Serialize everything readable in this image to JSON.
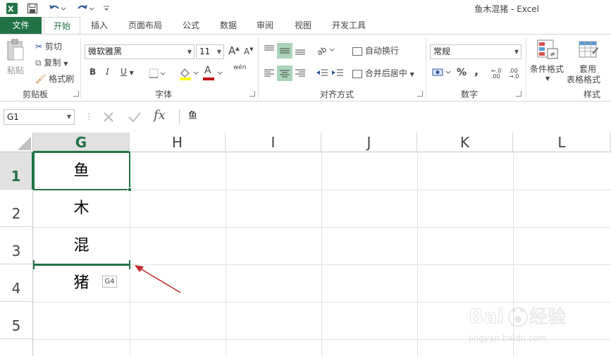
{
  "window": {
    "title": "鱼木混猪 - Excel"
  },
  "quick_access": {
    "app_icon": "excel-icon",
    "save_icon": "save-icon",
    "undo_icon": "undo-icon",
    "redo_icon": "redo-icon"
  },
  "tabs": [
    {
      "label": "文件"
    },
    {
      "label": "开始"
    },
    {
      "label": "插入"
    },
    {
      "label": "页面布局"
    },
    {
      "label": "公式"
    },
    {
      "label": "数据"
    },
    {
      "label": "审阅"
    },
    {
      "label": "视图"
    },
    {
      "label": "开发工具"
    }
  ],
  "ribbon": {
    "clipboard": {
      "paste": "粘贴",
      "cut": "剪切",
      "copy": "复制",
      "format_painter": "格式刷",
      "label": "剪贴板"
    },
    "font": {
      "name": "微软雅黑",
      "size": "11",
      "bold": "B",
      "italic": "I",
      "underline": "U",
      "grow": "A",
      "shrink": "A",
      "wen": "wén",
      "label": "字体",
      "text_a": "A"
    },
    "alignment": {
      "wrap": "自动换行",
      "merge": "合并后居中",
      "label": "对齐方式"
    },
    "number": {
      "format": "常规",
      "percent": "%",
      "comma": ",",
      "label": "数字",
      "inc_dec": "←.0 .00",
      "dec_dec": ".00 →.0"
    },
    "styles": {
      "conditional": "条件格式",
      "table_format_1": "套用",
      "table_format_2": "表格格式",
      "label": "样式"
    }
  },
  "formula_bar": {
    "name_box": "G1",
    "value": "鱼",
    "fx": "fx"
  },
  "columns": [
    "G",
    "H",
    "I",
    "J",
    "K",
    "L"
  ],
  "rows": [
    "1",
    "2",
    "3",
    "4",
    "5"
  ],
  "cells": {
    "G1": "鱼",
    "G2": "木",
    "G3": "混",
    "G4": "猪"
  },
  "drag_tooltip": "G4",
  "colors": {
    "accent": "#217346",
    "arrow": "#c0292b"
  }
}
